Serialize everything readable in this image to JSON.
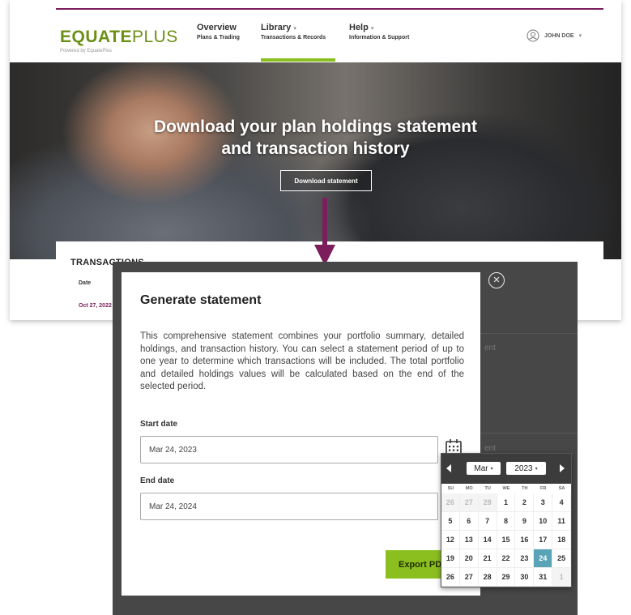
{
  "site": {
    "logo_main": "EQUATE",
    "logo_plus": "PLUS",
    "logo_sub": "Powered by EquatePlus",
    "nav": [
      {
        "title": "Overview",
        "subtitle": "Plans & Trading"
      },
      {
        "title": "Library",
        "subtitle": "Transactions & Records"
      },
      {
        "title": "Help",
        "subtitle": "Information & Support"
      }
    ],
    "user_name": "JOHN DOE",
    "hero_title_line1": "Download your plan holdings statement",
    "hero_title_line2": "and transaction history",
    "download_button": "Download statement",
    "transactions_heading": "TRANSACTIONS",
    "transactions_date_header": "Date",
    "transactions_first_date": "Oct 27, 2022"
  },
  "modal": {
    "title": "Generate statement",
    "description": "This comprehensive statement combines your portfolio summary, detailed holdings, and transaction history. You can select a statement period of up to one year to determine which transactions will be included. The total portfolio and detailed holdings values will be calculated based on the end of the selected period.",
    "start_label": "Start date",
    "start_value": "Mar 24, 2023",
    "end_label": "End date",
    "end_value": "Mar 24, 2024",
    "export_button": "Export PDF",
    "behind_text": "ent"
  },
  "datepicker": {
    "month": "Mar",
    "year": "2023",
    "weekdays": [
      "SU",
      "MO",
      "TU",
      "WE",
      "TH",
      "FR",
      "SA"
    ],
    "weeks": [
      [
        {
          "d": "26",
          "m": true
        },
        {
          "d": "27",
          "m": true
        },
        {
          "d": "28",
          "m": true
        },
        {
          "d": "1"
        },
        {
          "d": "2"
        },
        {
          "d": "3"
        },
        {
          "d": "4"
        }
      ],
      [
        {
          "d": "5"
        },
        {
          "d": "6"
        },
        {
          "d": "7"
        },
        {
          "d": "8"
        },
        {
          "d": "9"
        },
        {
          "d": "10"
        },
        {
          "d": "11"
        }
      ],
      [
        {
          "d": "12"
        },
        {
          "d": "13"
        },
        {
          "d": "14"
        },
        {
          "d": "15"
        },
        {
          "d": "16"
        },
        {
          "d": "17"
        },
        {
          "d": "18"
        }
      ],
      [
        {
          "d": "19"
        },
        {
          "d": "20"
        },
        {
          "d": "21"
        },
        {
          "d": "22"
        },
        {
          "d": "23"
        },
        {
          "d": "24",
          "s": true
        },
        {
          "d": "25"
        }
      ],
      [
        {
          "d": "26"
        },
        {
          "d": "27"
        },
        {
          "d": "28"
        },
        {
          "d": "29"
        },
        {
          "d": "30"
        },
        {
          "d": "31"
        },
        {
          "d": "1",
          "m": true
        }
      ]
    ]
  },
  "colors": {
    "brand_purple": "#7b1e5b",
    "brand_green": "#8bbf1f",
    "selected_day": "#5aa4b8"
  }
}
